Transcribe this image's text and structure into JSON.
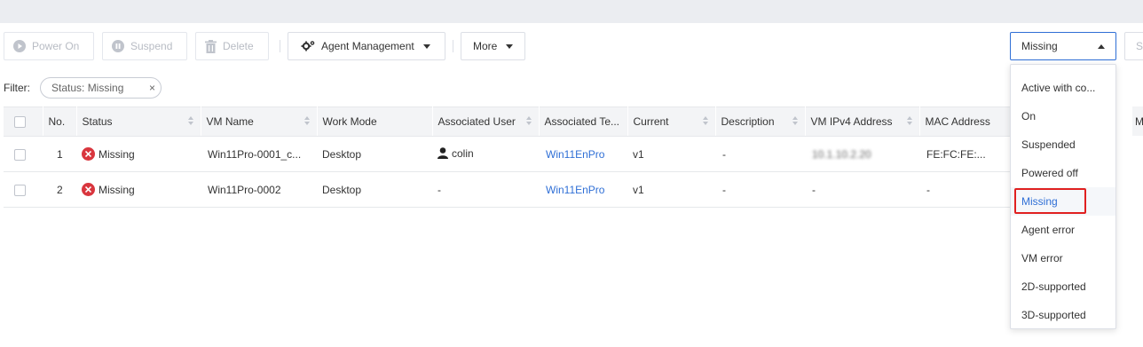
{
  "toolbar": {
    "power_on": "Power On",
    "suspend": "Suspend",
    "delete": "Delete",
    "agent_management": "Agent Management",
    "more": "More"
  },
  "status_select": {
    "value": "Missing"
  },
  "search": {
    "placeholder": "S"
  },
  "filter": {
    "label": "Filter:",
    "tag": "Status: Missing"
  },
  "table": {
    "columns": [
      "No.",
      "Status",
      "VM Name",
      "Work Mode",
      "Associated User",
      "Associated Te...",
      "Current",
      "Description",
      "VM IPv4 Address",
      "MAC Address"
    ],
    "cut_column": "M",
    "rows": [
      {
        "no": "1",
        "status": "Missing",
        "vm_name": "Win11Pro-0001_c...",
        "work_mode": "Desktop",
        "user": "colin",
        "template": "Win11EnPro",
        "current": "v1",
        "description": "-",
        "ipv4": "10.1.10.2.20",
        "mac": "FE:FC:FE:..."
      },
      {
        "no": "2",
        "status": "Missing",
        "vm_name": "Win11Pro-0002",
        "work_mode": "Desktop",
        "user": "-",
        "template": "Win11EnPro",
        "current": "v1",
        "description": "-",
        "ipv4": "-",
        "mac": "-"
      }
    ]
  },
  "dropdown": {
    "items": [
      "Active with co...",
      "On",
      "Suspended",
      "Powered off",
      "Missing",
      "Agent error",
      "VM error",
      "2D-supported",
      "3D-supported"
    ],
    "selected": "Missing"
  },
  "colors": {
    "accent": "#2f6fd6",
    "error": "#d9363e",
    "highlight": "#e02020"
  }
}
